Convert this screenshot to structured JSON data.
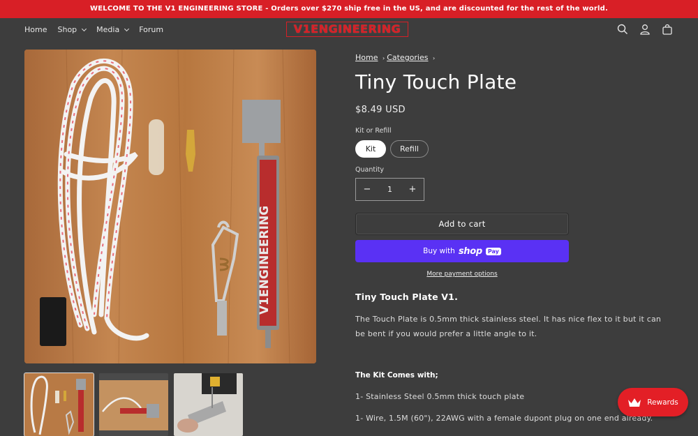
{
  "announcement": {
    "bold": "WELCOME TO THE V1 ENGINEERING STORE",
    "rest": " - Orders over $270 ship free in the US, and are discounted for the rest of the world."
  },
  "nav": {
    "home": "Home",
    "shop": "Shop",
    "media": "Media",
    "forum": "Forum"
  },
  "logo_text": "V1ENGINEERING",
  "header_icons": [
    "search-icon",
    "account-icon",
    "cart-icon"
  ],
  "breadcrumb": {
    "home": "Home",
    "categories": "Categories",
    "sep": "›"
  },
  "product": {
    "title": "Tiny Touch Plate",
    "price": "$8.49 USD",
    "option_label": "Kit or Refill",
    "options": [
      "Kit",
      "Refill"
    ],
    "selected_option": "Kit",
    "quantity_label": "Quantity",
    "quantity": "1",
    "minus": "−",
    "plus": "+",
    "add_to_cart": "Add to cart",
    "buy_with": "Buy with",
    "shop_word": "shop",
    "pay_word": "Pay",
    "more_payment": "More payment options"
  },
  "description": {
    "heading": "Tiny Touch Plate V1.",
    "paragraph": "The Touch Plate is 0.5mm thick stainless steel. It has nice flex to it but it can be bent if you would prefer a little angle to it.",
    "kit_heading": "The Kit Comes with;",
    "item1": "1- Stainless Steel 0.5mm thick touch plate",
    "item2": "1- Wire, 1.5M (60\"), 22AWG with a female dupont plug on one end already."
  },
  "plate_text": "V1ENGINEERING",
  "rewards_label": "Rewards",
  "colors": {
    "brand_red": "#d81f26",
    "background": "#3d3d3d",
    "shop_pay_purple": "#5a31f4"
  }
}
